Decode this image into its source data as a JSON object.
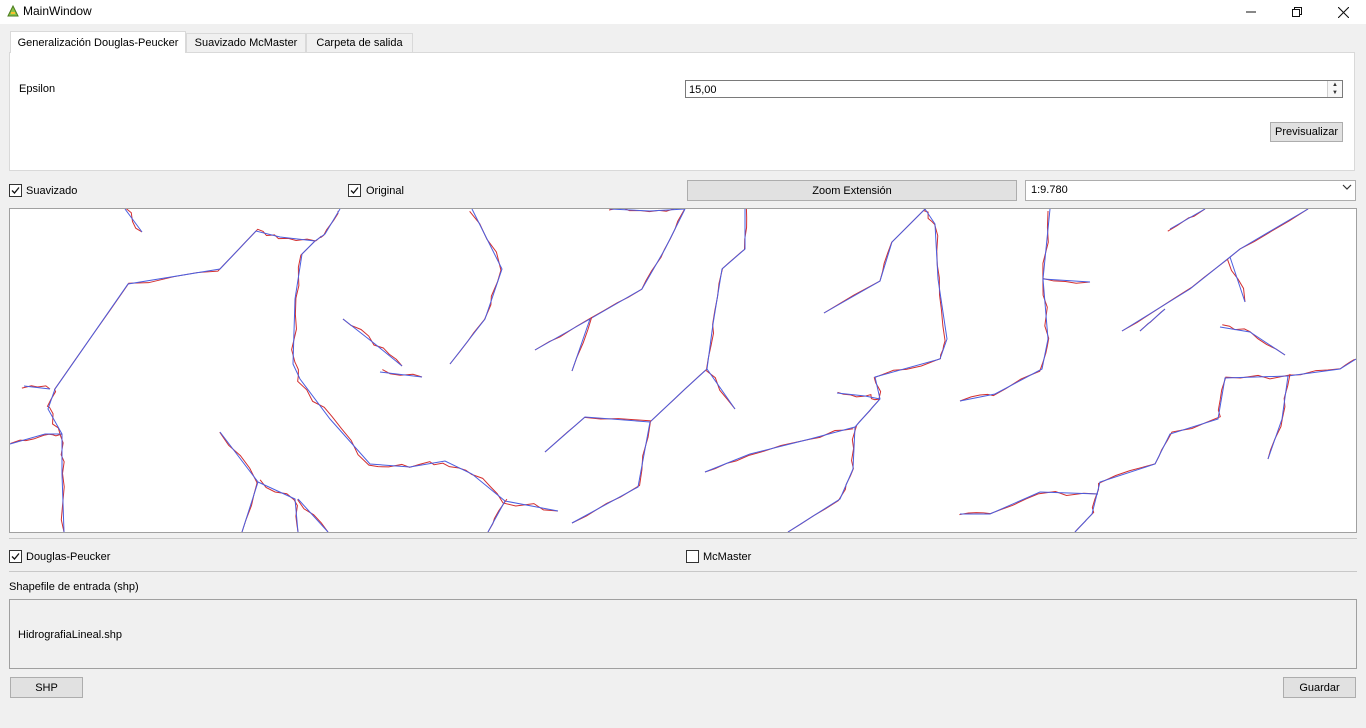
{
  "window": {
    "title": "MainWindow"
  },
  "tabs": [
    {
      "label": "Generalización Douglas-Peucker",
      "active": true
    },
    {
      "label": "Suavizado McMaster",
      "active": false
    },
    {
      "label": "Carpeta de salida",
      "active": false
    }
  ],
  "douglas_tab": {
    "epsilon_label": "Epsilon",
    "epsilon_value": "15,00",
    "preview_button": "Previsualizar"
  },
  "display_options": {
    "smoothed": {
      "label": "Suavizado",
      "checked": true
    },
    "original": {
      "label": "Original",
      "checked": true
    },
    "zoom_button": "Zoom Extensión",
    "scale_value": "1:9.780"
  },
  "map_colors": {
    "original": "#d32f2f",
    "generalized": "#4a5ee0"
  },
  "algorithms": {
    "douglas": {
      "label": "Douglas-Peucker",
      "checked": true
    },
    "mcmaster": {
      "label": "McMaster",
      "checked": false
    }
  },
  "input": {
    "label": "Shapefile de entrada (shp)",
    "file": "HidrografiaLineal.shp",
    "shp_button": "SHP",
    "save_button": "Guardar"
  }
}
